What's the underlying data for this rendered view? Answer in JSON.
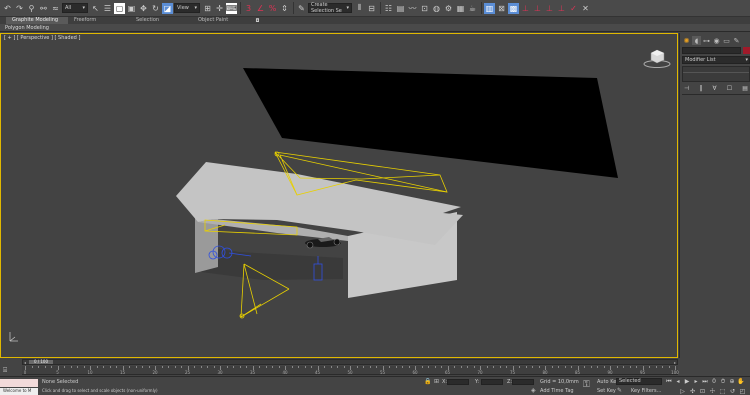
{
  "toolbar": {
    "selection_filter": "All",
    "view_dropdown": "View",
    "named_selection": "Create Selection Se"
  },
  "ribbon": {
    "tabs": [
      "Graphite Modeling Tools",
      "Freeform",
      "Selection",
      "Object Paint"
    ],
    "active_tab": 0,
    "sub_label": "Polygon Modeling"
  },
  "viewport": {
    "label": "[ + ] [ Perspective ] [ Shaded ]"
  },
  "command_panel": {
    "modifier_list": "Modifier List"
  },
  "timeline": {
    "frame_display": "0 / 100",
    "ticks": [
      0,
      5,
      10,
      15,
      20,
      25,
      30,
      35,
      40,
      45,
      50,
      55,
      60,
      65,
      70,
      75,
      80,
      85,
      90,
      95,
      100
    ]
  },
  "status": {
    "welcome": "Welcome to M",
    "selection_text": "None Selected",
    "prompt": "Click and drag to select and scale objects (non-uniformly)",
    "x_label": "X:",
    "y_label": "Y:",
    "z_label": "Z:",
    "grid": "Grid = 10,0mm",
    "add_time_tag": "Add Time Tag",
    "auto_key": "Auto Key",
    "set_key": "Set Key",
    "selected_dropdown": "Selected",
    "key_filters": "Key Filters..."
  },
  "colors": {
    "viewport_border": "#e0b800",
    "object_color": "#a01a2a",
    "light_wire": "#e8d000",
    "helper_blue": "#3050e0"
  }
}
